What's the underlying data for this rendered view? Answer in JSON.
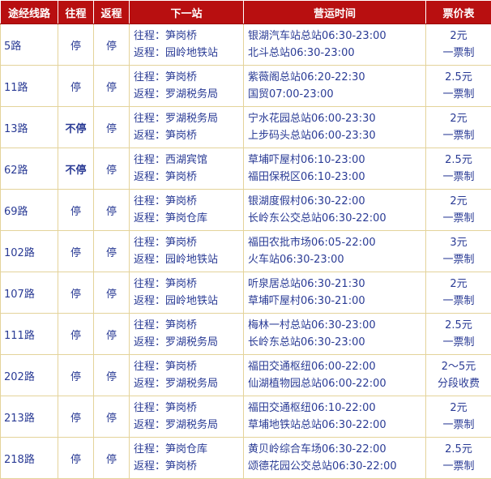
{
  "header": {
    "route": "途经线路",
    "to": "往程",
    "back": "返程",
    "next": "下一站",
    "hours": "营运时间",
    "fare": "票价表"
  },
  "rows": [
    {
      "route": "5路",
      "to": "停",
      "back": "停",
      "next_to": "往程：笋岗桥",
      "next_back": "返程：园岭地铁站",
      "time1": "银湖汽车站总站06:30-23:00",
      "time2": "北斗总站06:30-23:00",
      "fare1": "2元",
      "fare2": "一票制",
      "bold": false
    },
    {
      "route": "11路",
      "to": "停",
      "back": "停",
      "next_to": "往程：笋岗桥",
      "next_back": "返程：罗湖税务局",
      "time1": "紫薇阁总站06:20-22:30",
      "time2": "国贸07:00-23:00",
      "fare1": "2.5元",
      "fare2": "一票制",
      "bold": false
    },
    {
      "route": "13路",
      "to": "不停",
      "back": "停",
      "next_to": "往程：罗湖税务局",
      "next_back": "返程：笋岗桥",
      "time1": "宁水花园总站06:00-23:30",
      "time2": "上步码头总站06:00-23:30",
      "fare1": "2元",
      "fare2": "一票制",
      "bold": true
    },
    {
      "route": "62路",
      "to": "不停",
      "back": "停",
      "next_to": "往程：西湖宾馆",
      "next_back": "返程：笋岗桥",
      "time1": "草埔吓屋村06:10-23:00",
      "time2": "福田保税区06:10-23:00",
      "fare1": "2.5元",
      "fare2": "一票制",
      "bold": true
    },
    {
      "route": "69路",
      "to": "停",
      "back": "停",
      "next_to": "往程：笋岗桥",
      "next_back": "返程：笋岗仓库",
      "time1": "银湖度假村06:30-22:00",
      "time2": "长岭东公交总站06:30-22:00",
      "fare1": "2元",
      "fare2": "一票制",
      "bold": false
    },
    {
      "route": "102路",
      "to": "停",
      "back": "停",
      "next_to": "往程：笋岗桥",
      "next_back": "返程：园岭地铁站",
      "time1": "福田农批市场06:05-22:00",
      "time2": "火车站06:30-23:00",
      "fare1": "3元",
      "fare2": "一票制",
      "bold": false
    },
    {
      "route": "107路",
      "to": "停",
      "back": "停",
      "next_to": "往程：笋岗桥",
      "next_back": "返程：园岭地铁站",
      "time1": "听泉居总站06:30-21:30",
      "time2": "草埔吓屋村06:30-21:00",
      "fare1": "2元",
      "fare2": "一票制",
      "bold": false
    },
    {
      "route": "111路",
      "to": "停",
      "back": "停",
      "next_to": "往程：笋岗桥",
      "next_back": "返程：罗湖税务局",
      "time1": "梅林一村总站06:30-23:00",
      "time2": "长岭东总站06:30-23:00",
      "fare1": "2.5元",
      "fare2": "一票制",
      "bold": false
    },
    {
      "route": "202路",
      "to": "停",
      "back": "停",
      "next_to": "往程：笋岗桥",
      "next_back": "返程：罗湖税务局",
      "time1": "福田交通枢纽06:00-22:00",
      "time2": "仙湖植物园总站06:00-22:00",
      "fare1": "2～5元",
      "fare2": "分段收费",
      "bold": false
    },
    {
      "route": "213路",
      "to": "停",
      "back": "停",
      "next_to": "往程：笋岗桥",
      "next_back": "返程：罗湖税务局",
      "time1": "福田交通枢纽06:10-22:00",
      "time2": "草埔地铁站总站06:30-22:00",
      "fare1": "2元",
      "fare2": "一票制",
      "bold": false
    },
    {
      "route": "218路",
      "to": "停",
      "back": "停",
      "next_to": "往程：笋岗仓库",
      "next_back": "返程：笋岗桥",
      "time1": "黄贝岭综合车场06:30-22:00",
      "time2": "颂德花园公交总站06:30-22:00",
      "fare1": "2.5元",
      "fare2": "一票制",
      "bold": false
    }
  ]
}
